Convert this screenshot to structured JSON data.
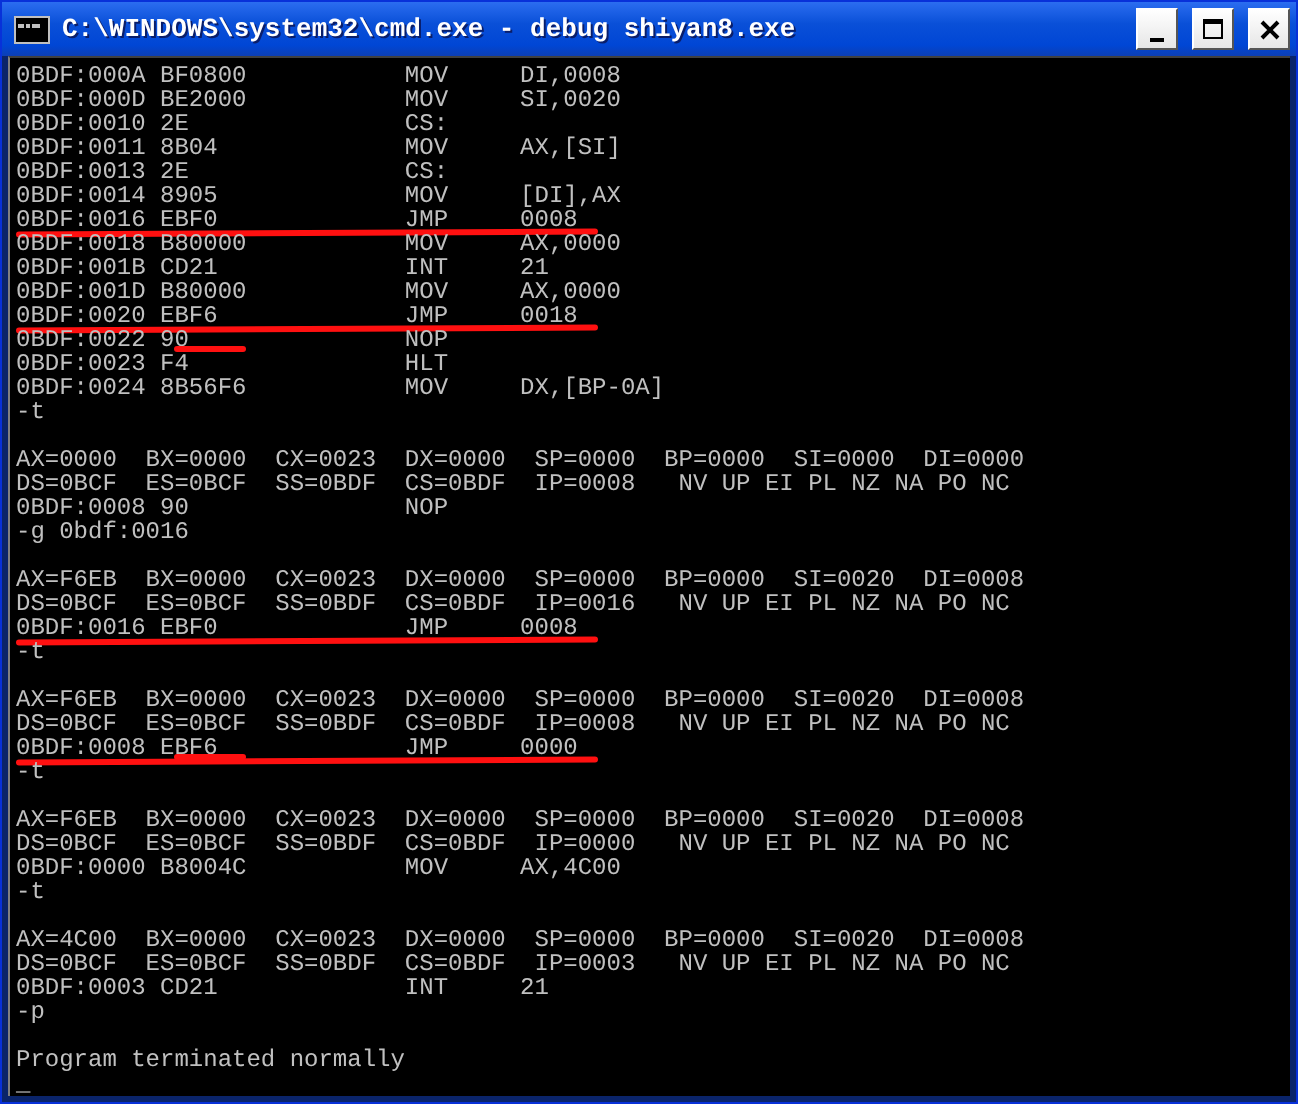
{
  "window": {
    "title": "C:\\WINDOWS\\system32\\cmd.exe - debug shiyan8.exe"
  },
  "console": {
    "lines": [
      {
        "kind": "text",
        "text": "0BDF:000A BF0800           MOV     DI,0008"
      },
      {
        "kind": "text",
        "text": "0BDF:000D BE2000           MOV     SI,0020"
      },
      {
        "kind": "text",
        "text": "0BDF:0010 2E               CS:"
      },
      {
        "kind": "text",
        "text": "0BDF:0011 8B04             MOV     AX,[SI]"
      },
      {
        "kind": "text",
        "text": "0BDF:0013 2E               CS:"
      },
      {
        "kind": "text",
        "text": "0BDF:0014 8905             MOV     [DI],AX"
      },
      {
        "kind": "text",
        "text": "0BDF:0016 EBF0             JMP     0008",
        "underlined": true
      },
      {
        "kind": "text",
        "text": "0BDF:0018 B80000           MOV     AX,0000"
      },
      {
        "kind": "text",
        "text": "0BDF:001B CD21             INT     21"
      },
      {
        "kind": "text",
        "text": "0BDF:001D B80000           MOV     AX,0000"
      },
      {
        "kind": "text",
        "text": "0BDF:0020 EBF6             JMP     0018",
        "underlined": true
      },
      {
        "kind": "text",
        "text": "0BDF:0022 90               NOP",
        "bytes_underlined": true
      },
      {
        "kind": "text",
        "text": "0BDF:0023 F4               HLT"
      },
      {
        "kind": "text",
        "text": "0BDF:0024 8B56F6           MOV     DX,[BP-0A]"
      },
      {
        "kind": "text",
        "text": "-t"
      },
      {
        "kind": "blank"
      },
      {
        "kind": "text",
        "text": "AX=0000  BX=0000  CX=0023  DX=0000  SP=0000  BP=0000  SI=0000  DI=0000"
      },
      {
        "kind": "text",
        "text": "DS=0BCF  ES=0BCF  SS=0BDF  CS=0BDF  IP=0008   NV UP EI PL NZ NA PO NC"
      },
      {
        "kind": "text",
        "text": "0BDF:0008 90               NOP"
      },
      {
        "kind": "text",
        "text": "-g 0bdf:0016"
      },
      {
        "kind": "blank"
      },
      {
        "kind": "text",
        "text": "AX=F6EB  BX=0000  CX=0023  DX=0000  SP=0000  BP=0000  SI=0020  DI=0008"
      },
      {
        "kind": "text",
        "text": "DS=0BCF  ES=0BCF  SS=0BDF  CS=0BDF  IP=0016   NV UP EI PL NZ NA PO NC"
      },
      {
        "kind": "text",
        "text": "0BDF:0016 EBF0             JMP     0008",
        "underlined": true
      },
      {
        "kind": "text",
        "text": "-t"
      },
      {
        "kind": "blank"
      },
      {
        "kind": "text",
        "text": "AX=F6EB  BX=0000  CX=0023  DX=0000  SP=0000  BP=0000  SI=0020  DI=0008"
      },
      {
        "kind": "text",
        "text": "DS=0BCF  ES=0BCF  SS=0BDF  CS=0BDF  IP=0008   NV UP EI PL NZ NA PO NC"
      },
      {
        "kind": "text",
        "text": "0BDF:0008 EBF6             JMP     0000",
        "underlined": true,
        "bytes_underlined": true
      },
      {
        "kind": "text",
        "text": "-t"
      },
      {
        "kind": "blank"
      },
      {
        "kind": "text",
        "text": "AX=F6EB  BX=0000  CX=0023  DX=0000  SP=0000  BP=0000  SI=0020  DI=0008"
      },
      {
        "kind": "text",
        "text": "DS=0BCF  ES=0BCF  SS=0BDF  CS=0BDF  IP=0000   NV UP EI PL NZ NA PO NC"
      },
      {
        "kind": "text",
        "text": "0BDF:0000 B8004C           MOV     AX,4C00"
      },
      {
        "kind": "text",
        "text": "-t"
      },
      {
        "kind": "blank"
      },
      {
        "kind": "text",
        "text": "AX=4C00  BX=0000  CX=0023  DX=0000  SP=0000  BP=0000  SI=0020  DI=0008"
      },
      {
        "kind": "text",
        "text": "DS=0BCF  ES=0BCF  SS=0BDF  CS=0BDF  IP=0003   NV UP EI PL NZ NA PO NC"
      },
      {
        "kind": "text",
        "text": "0BDF:0003 CD21             INT     21"
      },
      {
        "kind": "text",
        "text": "-p"
      },
      {
        "kind": "blank"
      },
      {
        "kind": "text",
        "text": "Program terminated normally"
      },
      {
        "kind": "text",
        "text": "_"
      }
    ]
  }
}
